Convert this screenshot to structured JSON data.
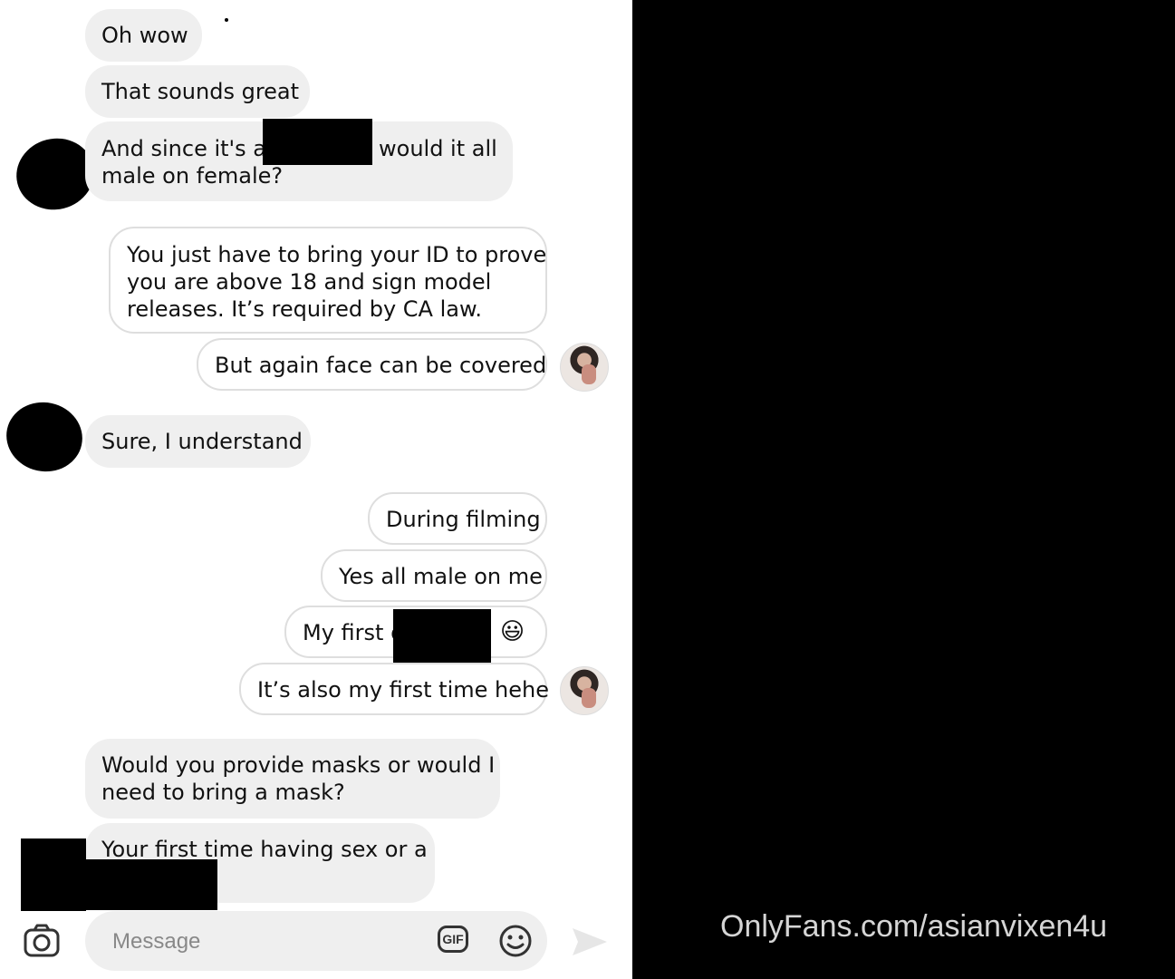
{
  "messages": [
    {
      "sender": "contact",
      "text": "Oh wow"
    },
    {
      "sender": "contact",
      "text": "That sounds great"
    },
    {
      "sender": "contact",
      "text_a": "And since it's a",
      "text_b": "would it all",
      "text_c": "male on female?"
    },
    {
      "sender": "self",
      "line1": "You just have to bring your ID to prove",
      "line2": "you are above 18 and sign model",
      "line3": "releases. It’s required by CA law."
    },
    {
      "sender": "self",
      "text": "But again face can be covered"
    },
    {
      "sender": "contact",
      "text": "Sure, I understand"
    },
    {
      "sender": "self",
      "text": "During filming"
    },
    {
      "sender": "self",
      "text": "Yes all male on me"
    },
    {
      "sender": "self",
      "text": "My first g",
      "emoji": "😃"
    },
    {
      "sender": "self",
      "text": "It’s also my first time hehe"
    },
    {
      "sender": "contact",
      "line1": "Would you provide masks or would I",
      "line2": "need to bring a mask?"
    },
    {
      "sender": "contact",
      "text": "Your first time having sex or a"
    }
  ],
  "composer": {
    "placeholder": "Message",
    "gif_label": "GIF",
    "camera_icon": "camera-icon",
    "sticker_icon": "smiley-icon",
    "send_icon": "send-icon"
  },
  "watermark": "OnlyFans.com/asianvixen4u",
  "colors": {
    "background": "#000000",
    "chat_background": "#ffffff",
    "incoming_bubble": "#efefef",
    "outgoing_border": "#dedede",
    "watermark_text": "#d5d5d5"
  }
}
